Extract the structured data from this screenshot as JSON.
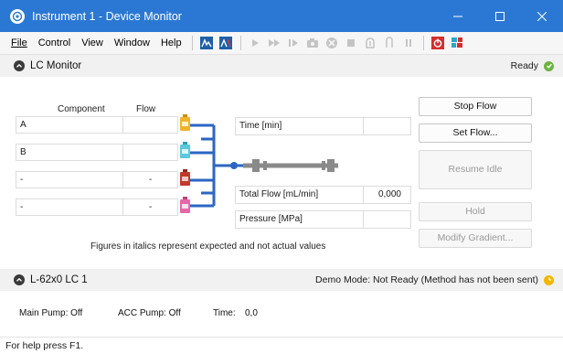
{
  "window": {
    "title": "Instrument 1 - Device Monitor",
    "colors": {
      "titlebar": "#2b78d4",
      "ready_green": "#6db33f",
      "warn_yellow": "#f2b705"
    }
  },
  "menu": [
    {
      "label": "File"
    },
    {
      "label": "Control"
    },
    {
      "label": "View"
    },
    {
      "label": "Window"
    },
    {
      "label": "Help"
    }
  ],
  "toolbar": {
    "icons": [
      "chromatogram-icon",
      "method-icon",
      "play-icon",
      "fast-forward-icon",
      "step-icon",
      "camera-icon",
      "stop-circle-icon",
      "stop-icon",
      "inject-icon",
      "needle-icon",
      "pause-icon",
      "power-icon",
      "network-icon"
    ]
  },
  "lc_monitor": {
    "title": "LC Monitor",
    "status": "Ready",
    "columns": {
      "component": "Component",
      "flow": "Flow"
    },
    "rows": [
      {
        "component": "A",
        "flow": "",
        "bottle_color": "#f0b429"
      },
      {
        "component": "B",
        "flow": "",
        "bottle_color": "#5bc8de"
      },
      {
        "component": "-",
        "flow": "-",
        "bottle_color": "#c0392b"
      },
      {
        "component": "-",
        "flow": "-",
        "bottle_color": "#e667a8"
      }
    ],
    "time_label": "Time [min]",
    "time_value": "",
    "total_flow_label": "Total Flow [mL/min]",
    "total_flow_value": "0,000",
    "pressure_label": "Pressure [MPa]",
    "pressure_value": "",
    "footnote": "Figures in italics represent expected and not actual values",
    "buttons": {
      "stop_flow": "Stop Flow",
      "set_flow": "Set Flow...",
      "resume_idle": "Resume Idle",
      "hold": "Hold",
      "modify_gradient": "Modify Gradient..."
    }
  },
  "pump": {
    "title": "L-62x0  LC 1",
    "status": "Demo Mode: Not Ready (Method has not been sent)",
    "main_pump": "Main Pump: Off",
    "acc_pump": "ACC Pump: Off",
    "time_label": "Time:",
    "time_value": "0,0"
  },
  "statusbar": {
    "text": "For help press F1."
  }
}
